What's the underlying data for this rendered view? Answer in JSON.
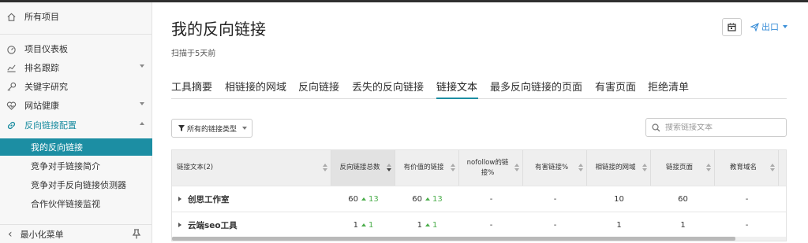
{
  "sidebar": {
    "all_projects": "所有项目",
    "items": [
      {
        "label": "项目仪表板"
      },
      {
        "label": "排名跟踪"
      },
      {
        "label": "关键字研究"
      },
      {
        "label": "网站健康"
      },
      {
        "label": "反向链接配置"
      }
    ],
    "sub_items": [
      {
        "label": "我的反向链接"
      },
      {
        "label": "竞争对手链接简介"
      },
      {
        "label": "竞争对手反向链接侦测器"
      },
      {
        "label": "合作伙伴链接监视"
      }
    ],
    "collapse_label": "最小化菜单"
  },
  "header": {
    "title": "我的反向链接",
    "scan_time": "扫描于5天前",
    "export_label": "出口"
  },
  "tabs": [
    {
      "label": "工具摘要"
    },
    {
      "label": "相链接的网域"
    },
    {
      "label": "反向链接"
    },
    {
      "label": "丢失的反向链接"
    },
    {
      "label": "链接文本"
    },
    {
      "label": "最多反向链接的页面"
    },
    {
      "label": "有害页面"
    },
    {
      "label": "拒绝清单"
    }
  ],
  "filter": {
    "label": "所有的链接类型"
  },
  "search": {
    "placeholder": "搜索链接文本"
  },
  "table": {
    "headers": [
      "链接文本(2)",
      "反向链接总数",
      "有价值的链接",
      "nofollow的链接%",
      "有害链接%",
      "相链接的网域",
      "链接页面",
      "教育域名"
    ],
    "rows": [
      {
        "text": "创思工作室",
        "total": "60",
        "total_delta": "13",
        "valuable": "60",
        "valuable_delta": "13",
        "nofollow": "-",
        "toxic": "-",
        "domains": "10",
        "pages": "60",
        "edu": "-"
      },
      {
        "text": "云端seo工具",
        "total": "1",
        "total_delta": "1",
        "valuable": "1",
        "valuable_delta": "1",
        "nofollow": "-",
        "toxic": "-",
        "domains": "1",
        "pages": "1",
        "edu": "-"
      }
    ]
  },
  "colors": {
    "accent": "#1c8ea3",
    "link": "#3b8fd8",
    "positive": "#4cae4c"
  }
}
